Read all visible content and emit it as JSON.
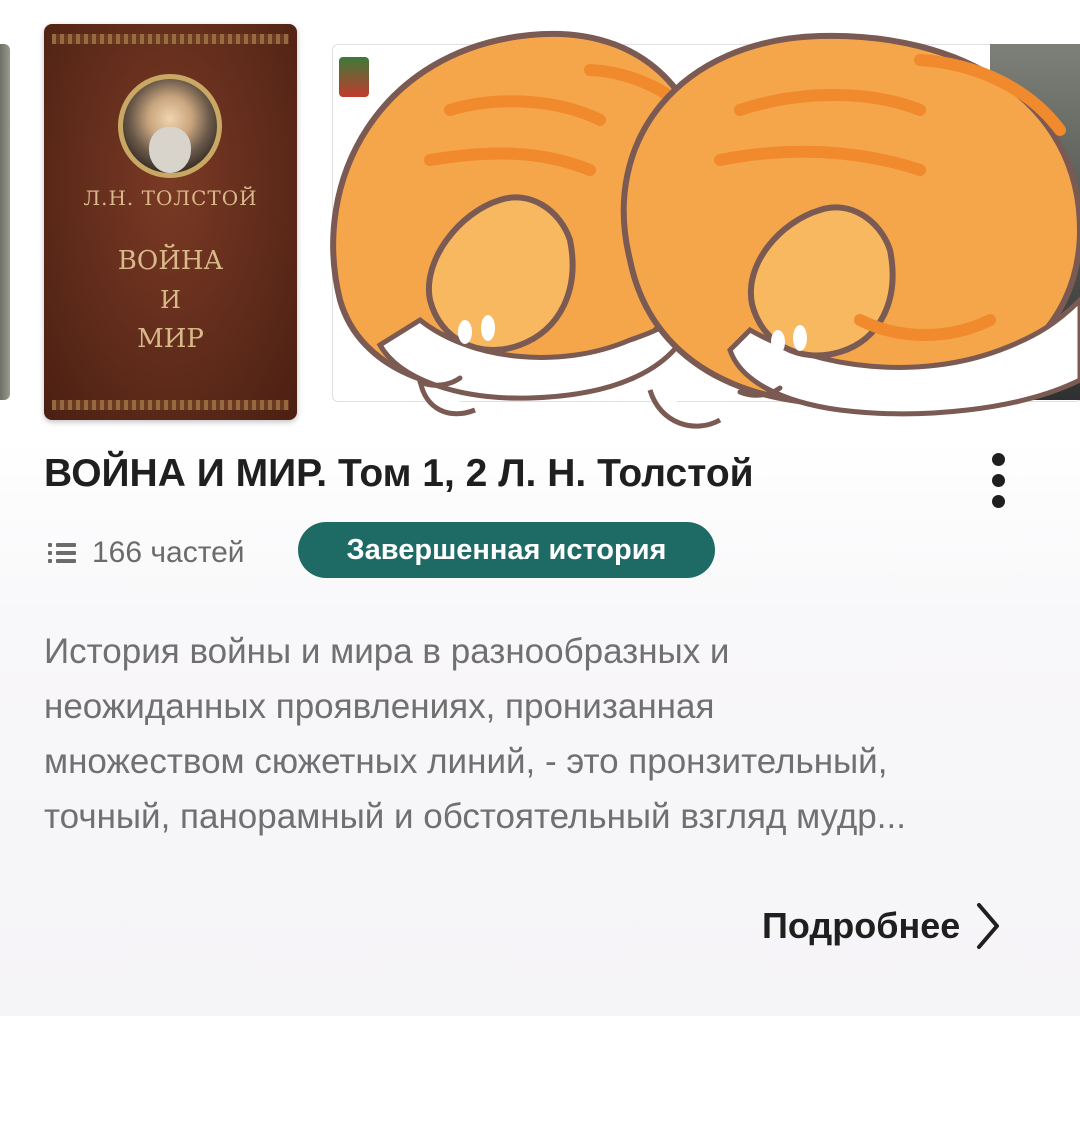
{
  "cover": {
    "author": "Л.Н. ТОЛСТОЙ",
    "title_line1": "ВОЙНА",
    "title_line2": "И",
    "title_line3": "МИР"
  },
  "book": {
    "title": "ВОЙНА И МИР. Том 1, 2 Л. Н. Толстой",
    "parts_label": "166 частей",
    "status": "Завершенная история",
    "description_lines": [
      "История войны и мира в разнообразных и",
      "неожиданных проявлениях, пронизанная",
      "множеством сюжетных линий, - это пронзительный,",
      "точный, панорамный и обстоятельный взгляд мудр..."
    ],
    "more_label": "Подробнее"
  },
  "colors": {
    "badge": "#1e6b66",
    "cover": "#5e2a1a",
    "cat_orange": "#f5a64a"
  },
  "icons": {
    "menu": "more-vert-icon",
    "parts": "list-icon",
    "more": "chevron-right-icon"
  }
}
